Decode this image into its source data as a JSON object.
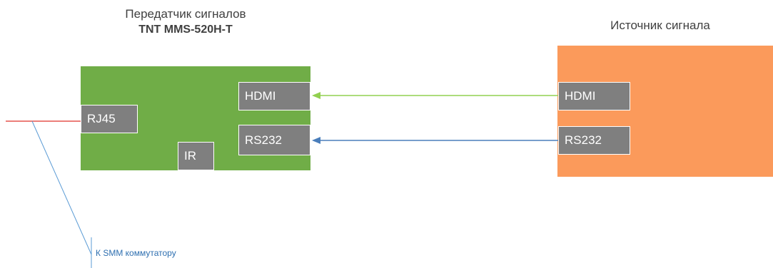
{
  "transmitter": {
    "title_line1": "Передатчик сигналов",
    "title_line2": "TNT MMS-520H-T",
    "color": "#70ad47",
    "ports": {
      "hdmi": "HDMI",
      "rs232": "RS232",
      "rj45": "RJ45",
      "ir": "IR"
    }
  },
  "source": {
    "title": "Источник сигнала",
    "color": "#fb9a5b",
    "ports": {
      "hdmi": "HDMI",
      "rs232": "RS232"
    }
  },
  "connections": {
    "hdmi_color": "#92d050",
    "rs232_color": "#4a7ebb",
    "rj45_color": "#e0302a",
    "smm_label": "К SMM коммутатору",
    "smm_color": "#5b9bd5"
  },
  "port_color": "#7f7f7f"
}
